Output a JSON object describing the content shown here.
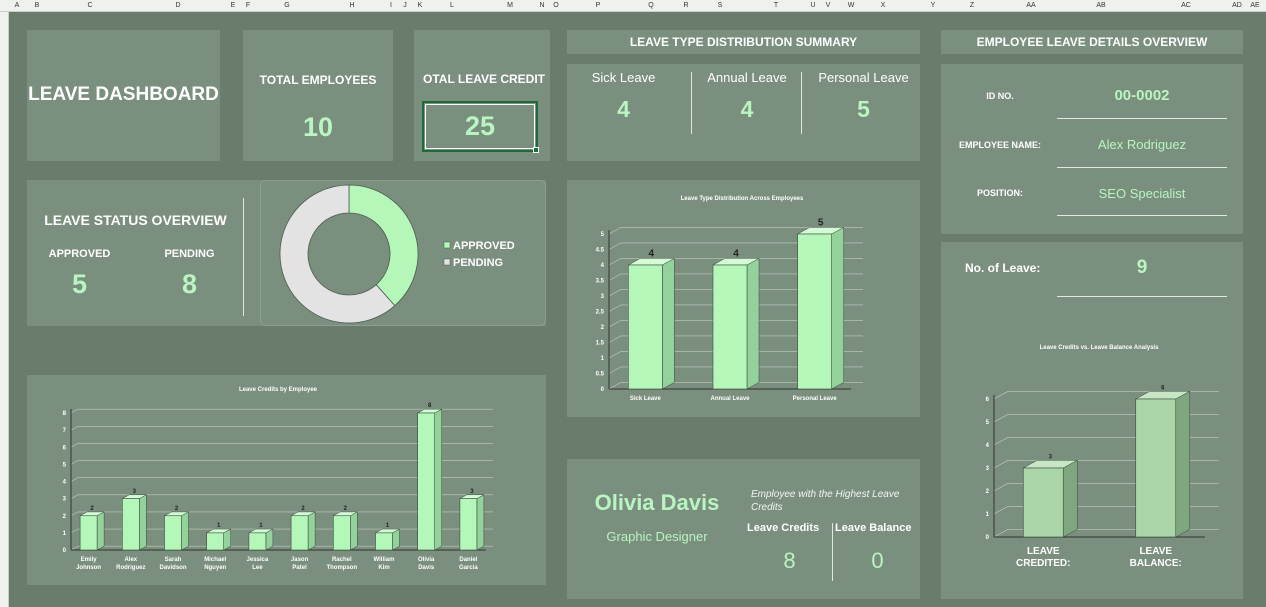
{
  "column_headers": [
    "A",
    "B",
    "C",
    "D",
    "E",
    "F",
    "G",
    "H",
    "I",
    "J",
    "K",
    "L",
    "M",
    "N",
    "O",
    "P",
    "Q",
    "R",
    "S",
    "T",
    "U",
    "V",
    "W",
    "X",
    "Y",
    "Z",
    "AA",
    "AB",
    "AC",
    "AD",
    "AE"
  ],
  "title": "LEAVE DASHBOARD",
  "total_employees": {
    "label": "TOTAL EMPLOYEES",
    "value": "10"
  },
  "total_leave_credit": {
    "label": "OTAL LEAVE CREDIT",
    "value": "25"
  },
  "leave_type_summary": {
    "header": "LEAVE TYPE DISTRIBUTION SUMMARY",
    "items": [
      {
        "label": "Sick Leave",
        "value": "4"
      },
      {
        "label": "Annual Leave",
        "value": "4"
      },
      {
        "label": "Personal Leave",
        "value": "5"
      }
    ]
  },
  "employee_details": {
    "header": "EMPLOYEE LEAVE DETAILS OVERVIEW",
    "id_label": "ID NO.",
    "id_value": "00-0002",
    "name_label": "EMPLOYEE NAME:",
    "name_value": "Alex Rodriguez",
    "position_label": "POSITION:",
    "position_value": "SEO Specialist"
  },
  "leave_status": {
    "title": "LEAVE STATUS OVERVIEW",
    "approved_label": "APPROVED",
    "approved_value": "5",
    "pending_label": "PENDING",
    "pending_value": "8"
  },
  "no_of_leave": {
    "label": "No. of Leave:",
    "value": "9"
  },
  "top_employee": {
    "name": "Olivia Davis",
    "role": "Graphic Designer",
    "caption": "Employee with the Highest Leave Credits",
    "credits_label": "Leave Credits",
    "balance_label": "Leave Balance",
    "credits_value": "8",
    "balance_value": "0"
  },
  "colors": {
    "accent": "#b8f5c0",
    "panel": "#7b8f7e",
    "background": "#6a7d6d",
    "bar": "#b4f7b9",
    "pending": "#e3e3e3"
  },
  "chart_data": [
    {
      "id": "status_donut",
      "type": "pie",
      "title": "",
      "categories": [
        "APPROVED",
        "PENDING"
      ],
      "values": [
        5,
        8
      ],
      "legend": "right"
    },
    {
      "id": "leave_type",
      "type": "bar",
      "title": "Leave Type Distribution Across Employees",
      "categories": [
        "Sick Leave",
        "Annual Leave",
        "Personal Leave"
      ],
      "values": [
        4,
        4,
        5
      ],
      "ylim": [
        0,
        5
      ],
      "yticks": [
        "0",
        "0.5",
        "1",
        "1.5",
        "2",
        "2.5",
        "3",
        "3.5",
        "4",
        "4.5",
        "5"
      ],
      "grid": true
    },
    {
      "id": "credits_by_employee",
      "type": "bar",
      "title": "Leave Credits by Employee",
      "categories": [
        "Emily Johnson",
        "Alex Rodriguez",
        "Sarah Davidson",
        "Michael Nguyen",
        "Jessica Lee",
        "Jason Patel",
        "Rachel Thompson",
        "William Kim",
        "Olivia Davis",
        "Daniel Garcia"
      ],
      "values": [
        2,
        3,
        2,
        1,
        1,
        2,
        2,
        1,
        8,
        3
      ],
      "ylim": [
        0,
        8
      ],
      "yticks": [
        "0",
        "1",
        "2",
        "3",
        "4",
        "5",
        "6",
        "7",
        "8"
      ],
      "grid": true
    },
    {
      "id": "credits_vs_balance",
      "type": "bar",
      "title": "Leave Credits vs. Leave Balance Analysis",
      "categories": [
        "LEAVE CREDITED:",
        "LEAVE BALANCE:"
      ],
      "values": [
        3,
        6
      ],
      "ylim": [
        0,
        6
      ],
      "yticks": [
        "0",
        "1",
        "2",
        "3",
        "4",
        "5",
        "6"
      ],
      "grid": true
    }
  ]
}
